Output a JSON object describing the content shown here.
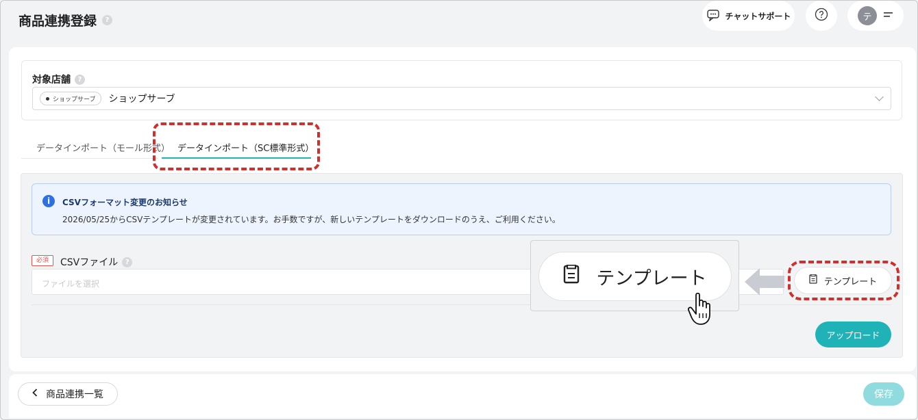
{
  "header": {
    "title": "商品連携登録",
    "help_mark": "?",
    "chat_support_label": "チャットサポート",
    "avatar_initial": "テ"
  },
  "store": {
    "label": "対象店舗",
    "chip_label": "ショップサーブ",
    "selected_value": "ショップサーブ"
  },
  "tabs": [
    {
      "label": "データインポート（モール形式）",
      "active": false
    },
    {
      "label": "データインポート（SC標準形式）",
      "active": true
    }
  ],
  "notice": {
    "icon": "i",
    "title": "CSVフォーマット変更のお知らせ",
    "body": "2026/05/25からCSVテンプレートが変更されています。お手数ですが、新しいテンプレートをダウンロードのうえ、ご利用ください。"
  },
  "csv": {
    "required_badge": "必須",
    "label": "CSVファイル",
    "placeholder": "ファイルを選択"
  },
  "buttons": {
    "template_label": "テンプレート",
    "upload_label": "アップロード",
    "back_label": "商品連携一覧",
    "save_label": "保存"
  },
  "zoom_callout": {
    "label": "テンプレート"
  },
  "colors": {
    "accent": "#1fb3b7",
    "highlight": "#d0302c",
    "info": "#2f6fe0"
  }
}
